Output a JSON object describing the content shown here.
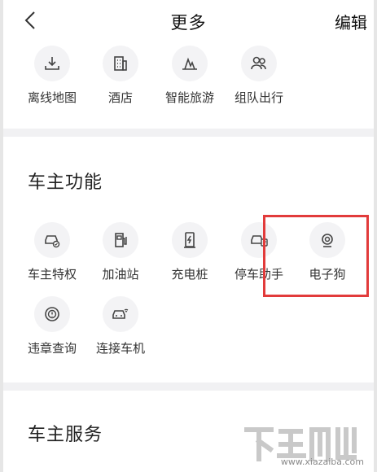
{
  "header": {
    "title": "更多",
    "edit_label": "编辑"
  },
  "top_row": [
    {
      "label": "离线地图",
      "icon": "offline-map-icon"
    },
    {
      "label": "酒店",
      "icon": "hotel-icon"
    },
    {
      "label": "智能旅游",
      "icon": "smart-travel-icon"
    },
    {
      "label": "组队出行",
      "icon": "team-travel-icon"
    }
  ],
  "car_owner_functions": {
    "title": "车主功能",
    "row1": [
      {
        "label": "车主特权",
        "icon": "car-privilege-icon"
      },
      {
        "label": "加油站",
        "icon": "gas-station-icon"
      },
      {
        "label": "充电桩",
        "icon": "charging-pile-icon"
      },
      {
        "label": "停车助手",
        "icon": "parking-assistant-icon"
      },
      {
        "label": "电子狗",
        "icon": "camera-radar-icon"
      }
    ],
    "row2": [
      {
        "label": "违章查询",
        "icon": "violation-query-icon"
      },
      {
        "label": "连接车机",
        "icon": "connect-car-icon"
      }
    ]
  },
  "car_owner_services": {
    "title": "车主服务"
  },
  "watermark": {
    "text": "www.xiazaiba.com"
  },
  "colors": {
    "highlight": "#e23b3b",
    "icon_bg": "#f3f3f5",
    "divider": "#f1f1f3"
  }
}
